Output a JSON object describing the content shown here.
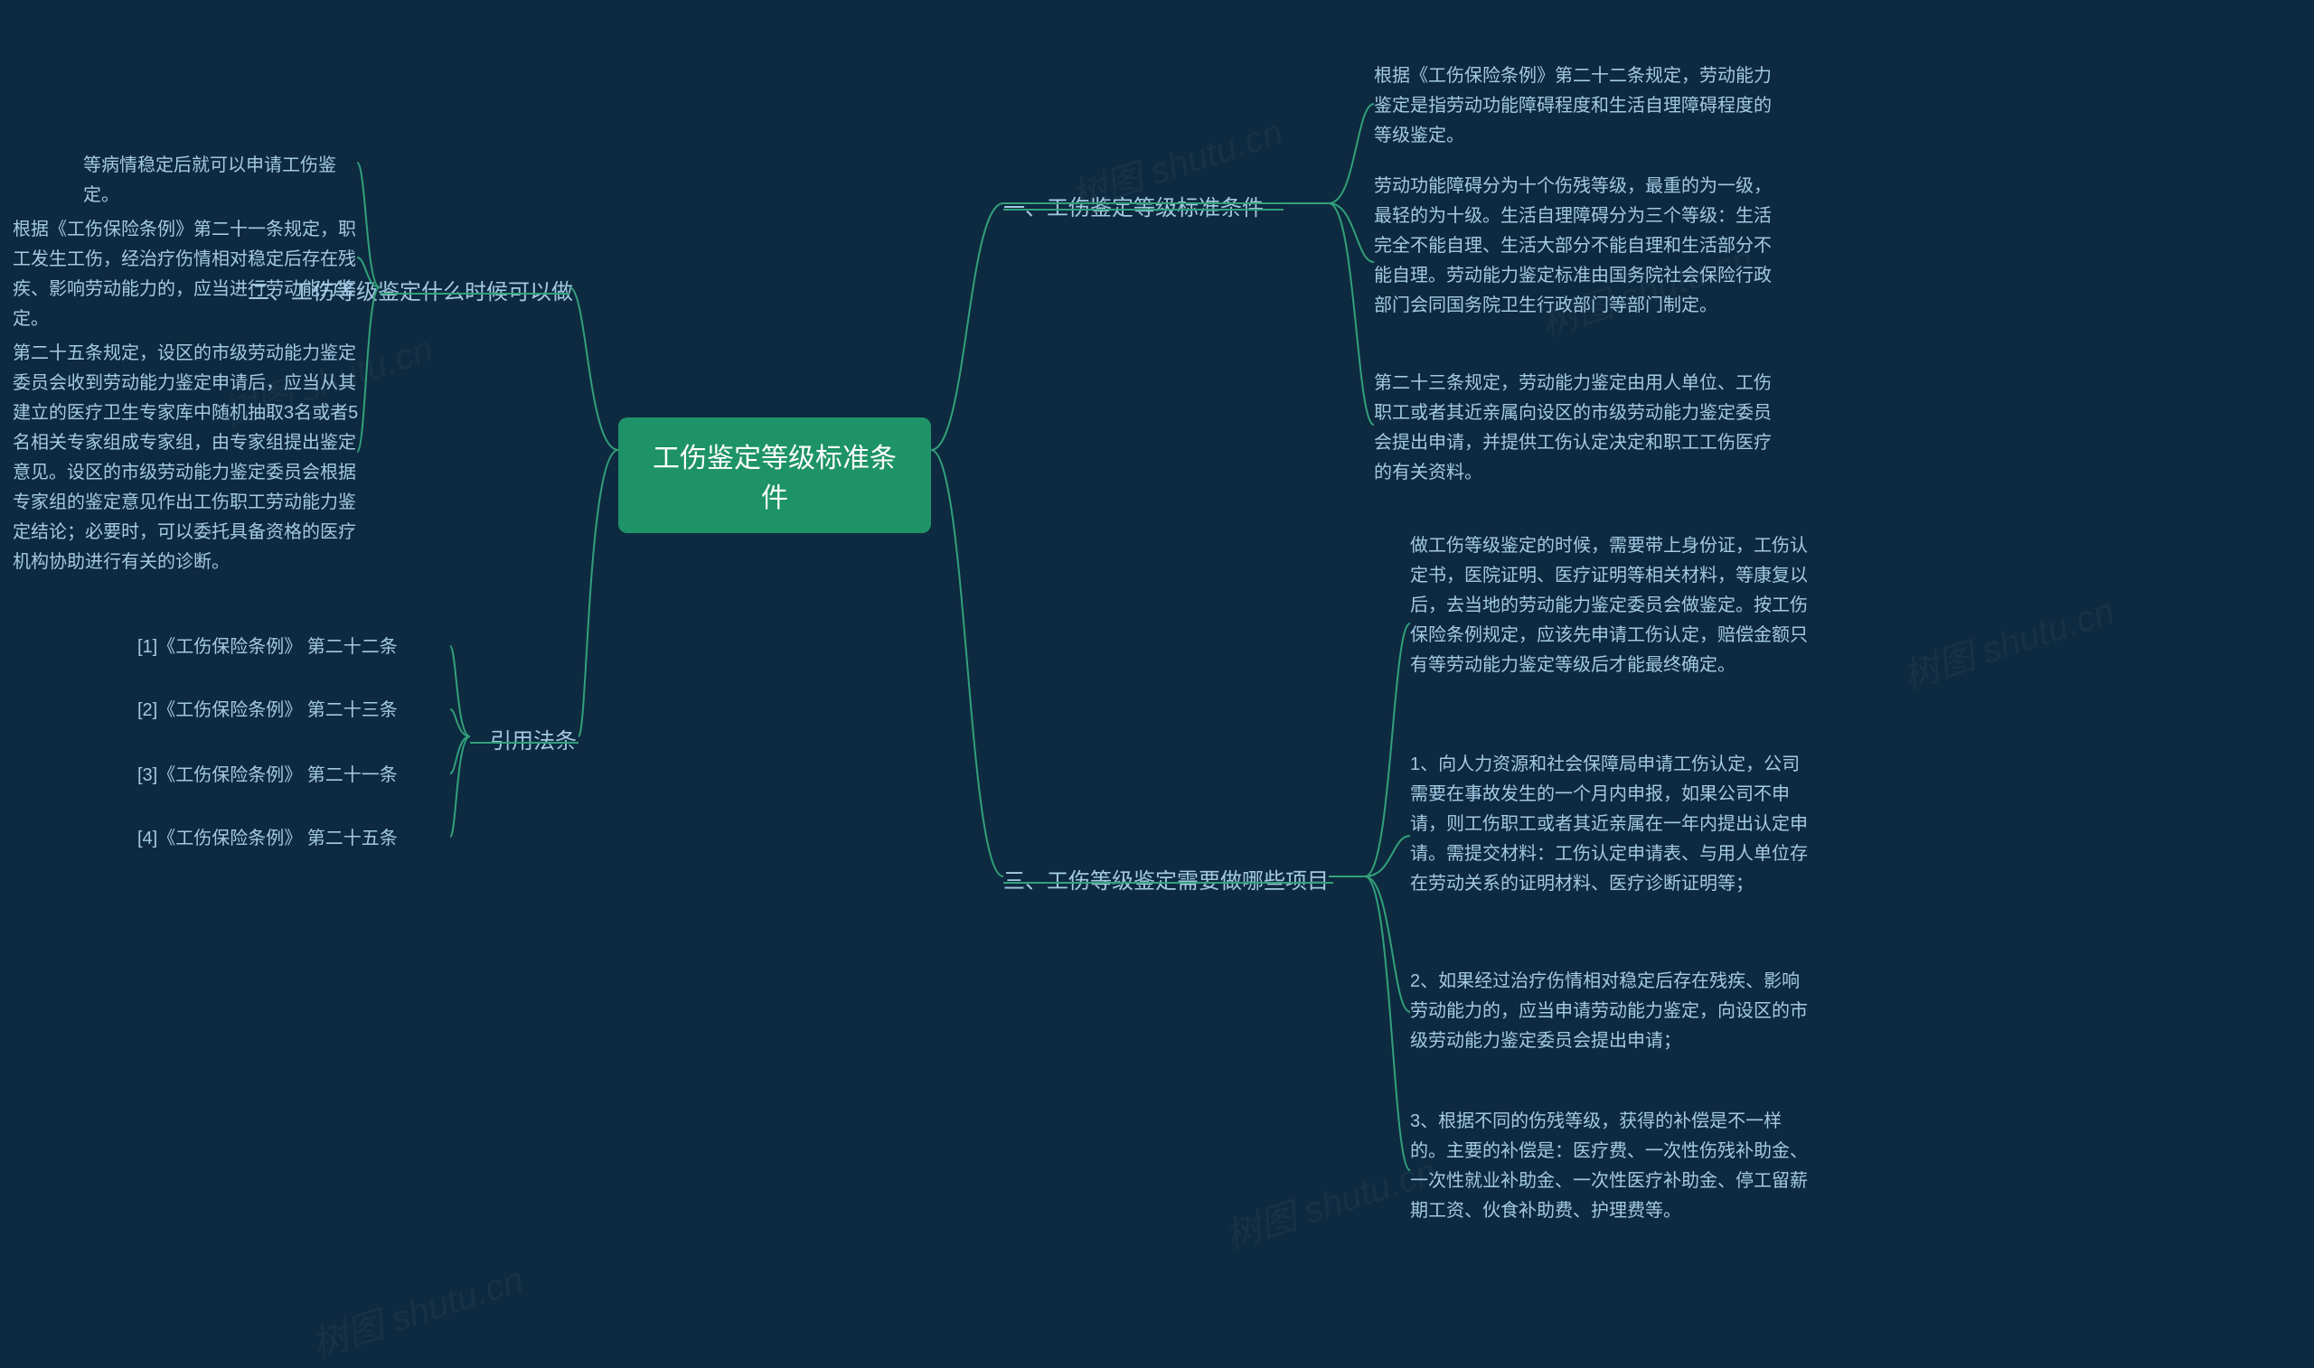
{
  "root": "工伤鉴定等级标准条件",
  "watermark": "树图 shutu.cn",
  "right": {
    "b1": {
      "label": "一、工伤鉴定等级标准条件",
      "items": [
        "根据《工伤保险条例》第二十二条规定，劳动能力鉴定是指劳动功能障碍程度和生活自理障碍程度的等级鉴定。",
        "劳动功能障碍分为十个伤残等级，最重的为一级，最轻的为十级。生活自理障碍分为三个等级：生活完全不能自理、生活大部分不能自理和生活部分不能自理。劳动能力鉴定标准由国务院社会保险行政部门会同国务院卫生行政部门等部门制定。",
        "第二十三条规定，劳动能力鉴定由用人单位、工伤职工或者其近亲属向设区的市级劳动能力鉴定委员会提出申请，并提供工伤认定决定和职工工伤医疗的有关资料。"
      ]
    },
    "b3": {
      "label": "三、工伤等级鉴定需要做哪些项目",
      "items": [
        "做工伤等级鉴定的时候，需要带上身份证，工伤认定书，医院证明、医疗证明等相关材料，等康复以后，去当地的劳动能力鉴定委员会做鉴定。按工伤保险条例规定，应该先申请工伤认定，赔偿金额只有等劳动能力鉴定等级后才能最终确定。",
        "1、向人力资源和社会保障局申请工伤认定，公司需要在事故发生的一个月内申报，如果公司不申请，则工伤职工或者其近亲属在一年内提出认定申请。需提交材料：工伤认定申请表、与用人单位存在劳动关系的证明材料、医疗诊断证明等；",
        "2、如果经过治疗伤情相对稳定后存在残疾、影响劳动能力的，应当申请劳动能力鉴定，向设区的市级劳动能力鉴定委员会提出申请；",
        "3、根据不同的伤残等级，获得的补偿是不一样的。主要的补偿是：医疗费、一次性伤残补助金、一次性就业补助金、一次性医疗补助金、停工留薪期工资、伙食补助费、护理费等。"
      ]
    }
  },
  "left": {
    "b2": {
      "label": "二、工伤等级鉴定什么时候可以做",
      "items": [
        "等病情稳定后就可以申请工伤鉴定。",
        "根据《工伤保险条例》第二十一条规定，职工发生工伤，经治疗伤情相对稳定后存在残疾、影响劳动能力的，应当进行劳动能力鉴定。",
        "第二十五条规定，设区的市级劳动能力鉴定委员会收到劳动能力鉴定申请后，应当从其建立的医疗卫生专家库中随机抽取3名或者5名相关专家组成专家组，由专家组提出鉴定意见。设区的市级劳动能力鉴定委员会根据专家组的鉴定意见作出工伤职工劳动能力鉴定结论；必要时，可以委托具备资格的医疗机构协助进行有关的诊断。"
      ]
    },
    "b4": {
      "label": "引用法条",
      "items": [
        "[1]《工伤保险条例》 第二十二条",
        "[2]《工伤保险条例》 第二十三条",
        "[3]《工伤保险条例》 第二十一条",
        "[4]《工伤保险条例》 第二十五条"
      ]
    }
  }
}
